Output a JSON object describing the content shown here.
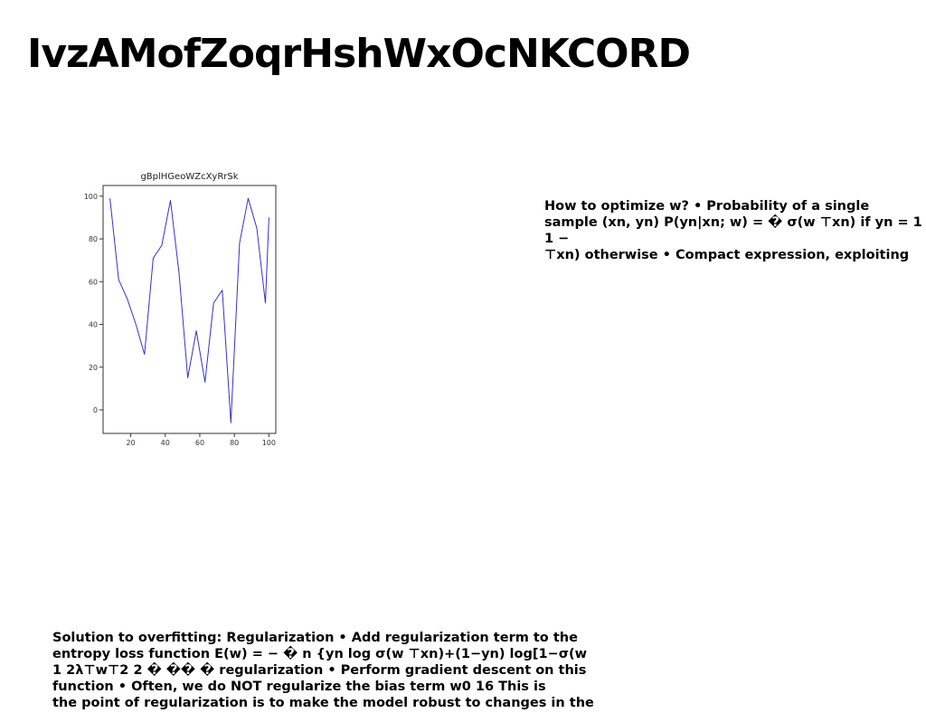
{
  "page": {
    "title": "IvzAMofZoqrHshWxOcNKCORD"
  },
  "text_blocks": {
    "right": "How to optimize w? • Probability of a single\nsample (xn, yn) P(yn|xn; w) = � σ(w ⊤xn) if yn = 1 1 −\n⊤xn) otherwise • Compact expression, exploiting",
    "bottom": "Solution to overfitting: Regularization • Add regularization term to the\nentropy loss function E(w) = − � n {yn log σ(w ⊤xn)+(1−yn) log[1−σ(w\n1 2λ⊤w⊤2 2 � �� � regularization • Perform gradient descent on this\nfunction • Often, we do NOT regularize the bias term w0 16 This is\nthe point of regularization is to make the model robust to changes in the"
  },
  "chart_data": {
    "type": "line",
    "title": "gBplHGeoWZcXyRrSk",
    "xlabel": "",
    "ylabel": "",
    "x": [
      8,
      13,
      18,
      23,
      28,
      33,
      38,
      43,
      48,
      53,
      58,
      63,
      68,
      73,
      78,
      83,
      88,
      93,
      98,
      100
    ],
    "series": [
      {
        "values": [
          99,
          61,
          52,
          40,
          26,
          71,
          77,
          98,
          64,
          15,
          37,
          13,
          50,
          56,
          -6,
          78,
          99,
          85,
          50,
          90
        ]
      }
    ],
    "xlim": [
      4,
      104
    ],
    "ylim": [
      -11,
      105
    ],
    "xticks": [
      20,
      40,
      60,
      80,
      100
    ],
    "yticks": [
      0,
      20,
      40,
      60,
      80,
      100
    ],
    "grid": false,
    "line_color": "#3333cc"
  }
}
